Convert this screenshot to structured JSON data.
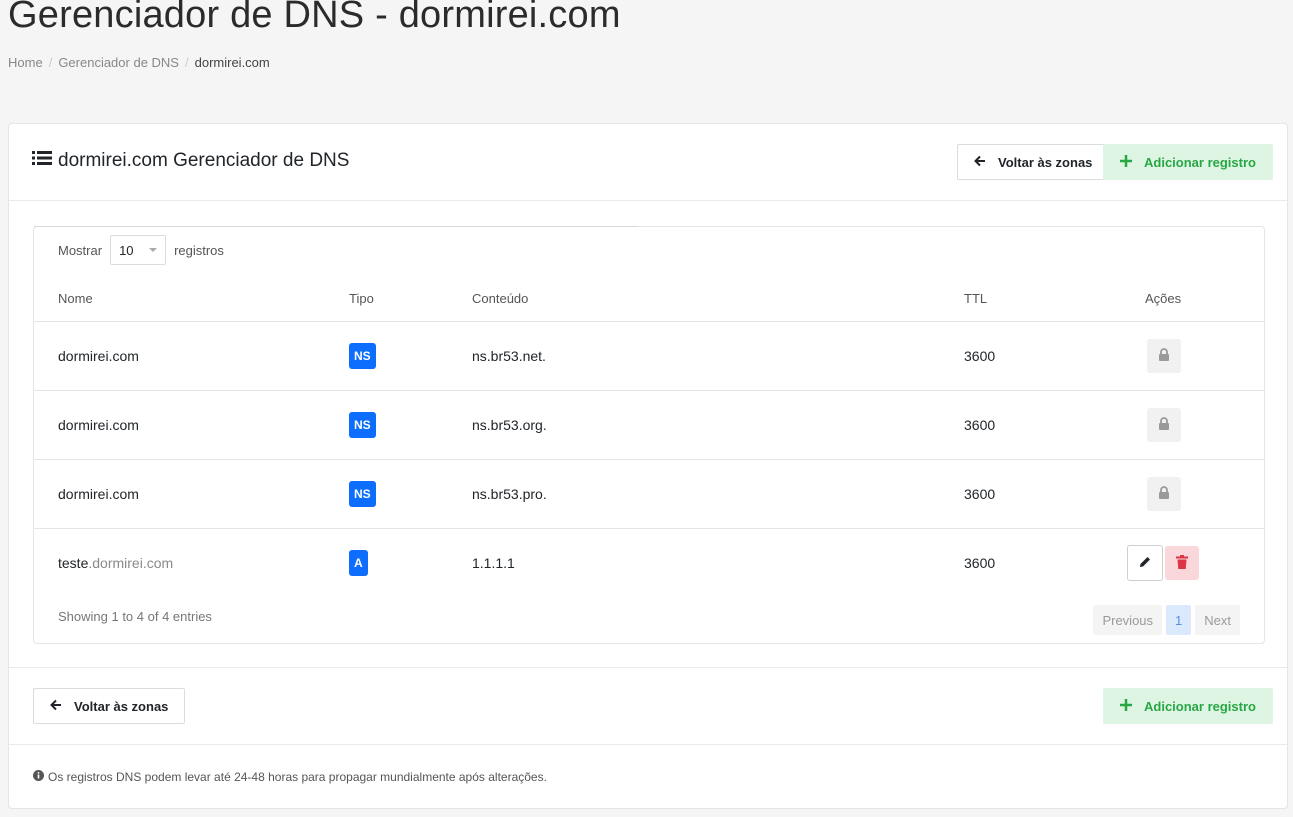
{
  "page": {
    "title": "Gerenciador de DNS - dormirei.com"
  },
  "breadcrumb": {
    "home": "Home",
    "dns": "Gerenciador de DNS",
    "current": "dormirei.com"
  },
  "card": {
    "title": "dormirei.com Gerenciador de DNS",
    "back_label": "Voltar às zonas",
    "add_label": "Adicionar registro"
  },
  "table": {
    "show_label": "Mostrar",
    "show_value": "10",
    "records_label": "registros",
    "headers": {
      "name": "Nome",
      "type": "Tipo",
      "content": "Conteúdo",
      "ttl": "TTL",
      "actions": "Ações"
    },
    "rows": [
      {
        "name": "dormirei.com",
        "type": "NS",
        "content": "ns.br53.net.",
        "ttl": "3600"
      },
      {
        "name": "dormirei.com",
        "type": "NS",
        "content": "ns.br53.org.",
        "ttl": "3600"
      },
      {
        "name": "dormirei.com",
        "type": "NS",
        "content": "ns.br53.pro.",
        "ttl": "3600"
      },
      {
        "name_sub": "teste",
        "name_domain": ".dormirei.com",
        "type": "A",
        "content": "1.1.1.1",
        "ttl": "3600"
      }
    ],
    "info": "Showing 1 to 4 of 4 entries",
    "pager": {
      "previous": "Previous",
      "current": "1",
      "next": "Next"
    }
  },
  "footer": {
    "back_label": "Voltar às zonas",
    "add_label": "Adicionar registro",
    "note": "Os registros DNS podem levar até 24-48 horas para propagar mundialmente após alterações."
  },
  "colors": {
    "accent_blue": "#0d6efd",
    "green": "#28a745",
    "danger": "#dc3545"
  },
  "icons": [
    "list-icon",
    "arrow-left-icon",
    "plus-icon",
    "lock-icon",
    "pencil-icon",
    "trash-icon",
    "info-icon"
  ]
}
